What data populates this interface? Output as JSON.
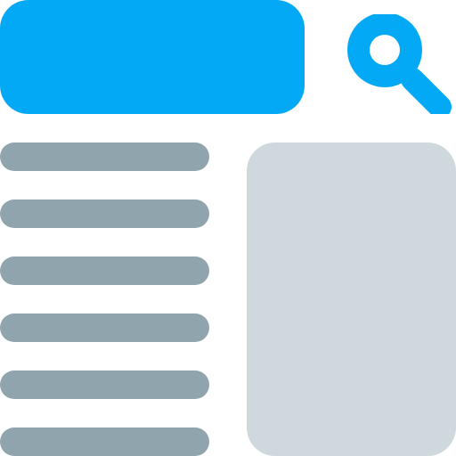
{
  "icon": {
    "name": "search-results-layout-icon"
  },
  "colors": {
    "accent": "#03a9f4",
    "list_item": "#90a4ae",
    "panel": "#cfd8dc",
    "background": "#ffffff"
  },
  "search": {
    "icon_name": "search-icon"
  },
  "list": {
    "items": [
      "",
      "",
      "",
      "",
      "",
      ""
    ]
  }
}
